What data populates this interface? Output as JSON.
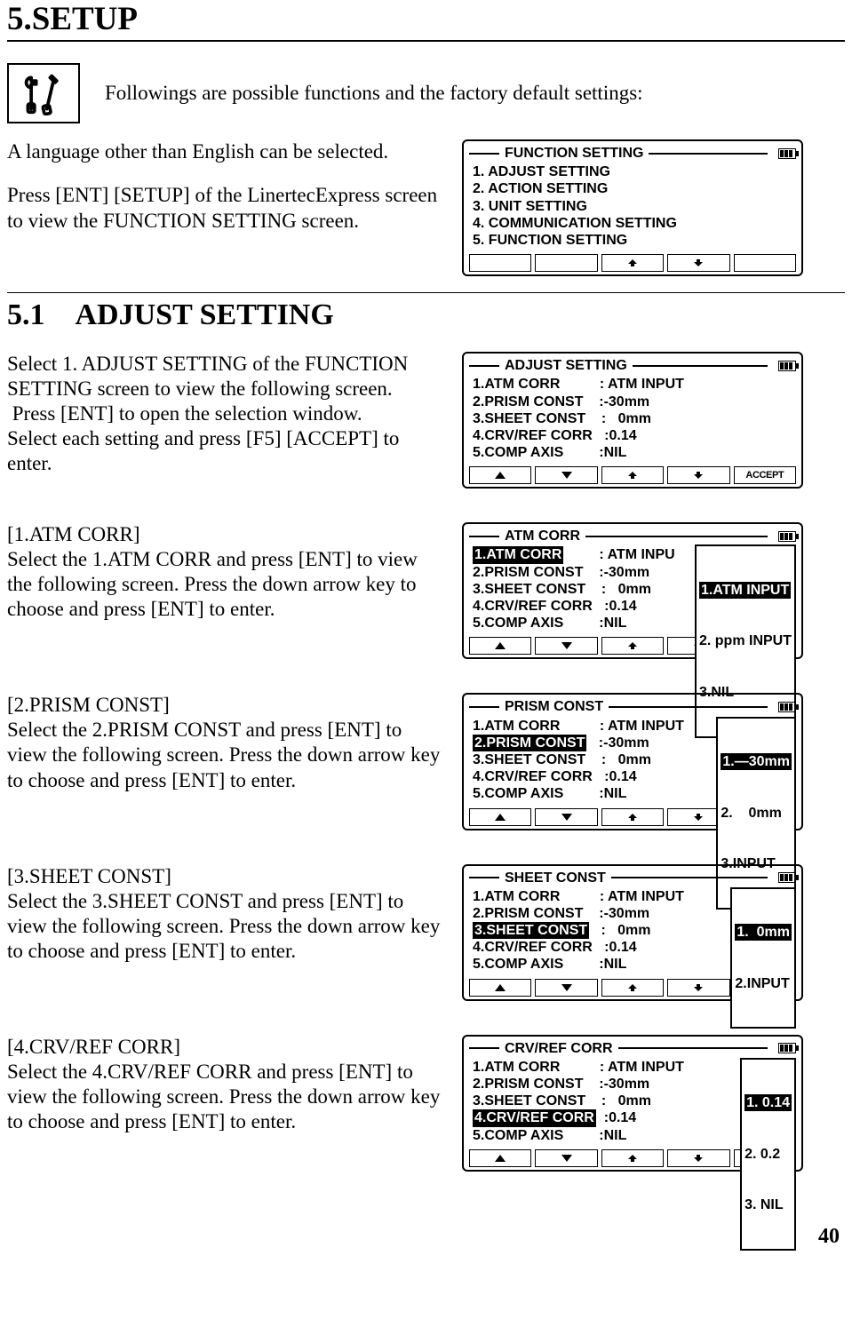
{
  "title": "5.SETUP",
  "intro_text": "Followings are possible functions and the factory default settings:",
  "para_lang": "A language other than English can be selected.",
  "para_press": "Press [ENT] [SETUP] of the LinertecExpress screen to view the FUNCTION SETTING screen.",
  "section51": "5.1 ADJUST SETTING",
  "para51a": "Select 1. ADJUST SETTING of the FUNCTION SETTING screen to view the following screen.",
  "para51b": " Press [ENT] to open the selection window.",
  "para51c": "Select each setting and press [F5] [ACCEPT] to enter.",
  "sub1_head": "[1.ATM CORR]",
  "sub1_body": "Select the 1.ATM CORR and press [ENT] to view the following screen. Press the down arrow key to choose and press [ENT] to enter.",
  "sub2_head": "[2.PRISM CONST]",
  "sub2_body": "Select the 2.PRISM CONST and press [ENT] to view the following screen. Press the down arrow key to choose and press [ENT] to enter.",
  "sub3_head": "[3.SHEET CONST]",
  "sub3_body": "Select the 3.SHEET CONST and press [ENT] to view the following screen. Press the down arrow key to choose and press [ENT] to enter.",
  "sub4_head": "[4.CRV/REF CORR]",
  "sub4_body": "Select the 4.CRV/REF CORR and press [ENT] to view the following screen. Press the down arrow key to choose and press [ENT] to enter.",
  "page_number": "40",
  "lcd_function": {
    "title": "FUNCTION  SETTING",
    "lines": [
      "1. ADJUST SETTING",
      "2. ACTION SETTING",
      "3. UNIT SETTING",
      "4. COMMUNICATION SETTING",
      "5. FUNCTION SETTING"
    ]
  },
  "lcd_adjust": {
    "title": "ADJUST SETTING",
    "l1": "1.ATM CORR          : ATM INPUT",
    "l2": "2.PRISM CONST    :-30mm",
    "l3": "3.SHEET CONST    :   0mm",
    "l4": "4.CRV/REF CORR   :0.14",
    "l5": "5.COMP AXIS         :NIL",
    "accept": "ACCEPT"
  },
  "lcd_atm": {
    "title": "ATM CORR",
    "l1_hl": "1.ATM CORR",
    "l1_rest": "         : ATM INPU",
    "l2": "2.PRISM CONST    :-30mm",
    "l3": "3.SHEET CONST    :   0mm",
    "l4": "4.CRV/REF CORR   :0.14",
    "l5": "5.COMP AXIS         :NIL",
    "popup_hl": "1.ATM INPUT",
    "popup2": "2. ppm INPUT",
    "popup3": "3.NIL"
  },
  "lcd_prism": {
    "title": "PRISM CONST",
    "l1": "1.ATM CORR          : ATM INPUT",
    "l2_hl": "2.PRISM CONST",
    "l2_rest": "   :-30mm",
    "l3": "3.SHEET CONST    :   0mm",
    "l4": "4.CRV/REF CORR   :0.14",
    "l5": "5.COMP AXIS         :NIL",
    "popup_hl": "1.—30mm",
    "popup2": "2.    0mm",
    "popup3": "3.INPUT"
  },
  "lcd_sheet": {
    "title": "SHEET CONST",
    "l1": "1.ATM CORR          : ATM INPUT",
    "l2": "2.PRISM CONST    :-30mm",
    "l3_hl": "3.SHEET CONST",
    "l3_rest": "   :   0mm",
    "l4": "4.CRV/REF CORR   :0.14",
    "l5": "5.COMP AXIS         :NIL",
    "popup_hl": "1.  0mm",
    "popup2": "2.INPUT"
  },
  "lcd_crv": {
    "title": "CRV/REF CORR",
    "l1": "1.ATM CORR          : ATM INPUT",
    "l2": "2.PRISM CONST    :-30mm",
    "l3": "3.SHEET CONST    :   0mm",
    "l4_hl": "4.CRV/REF CORR",
    "l4_rest": "  :0.14",
    "l5": "5.COMP AXIS         :NIL",
    "popup_hl": "1. 0.14",
    "popup2": "2. 0.2",
    "popup3": "3. NIL"
  }
}
